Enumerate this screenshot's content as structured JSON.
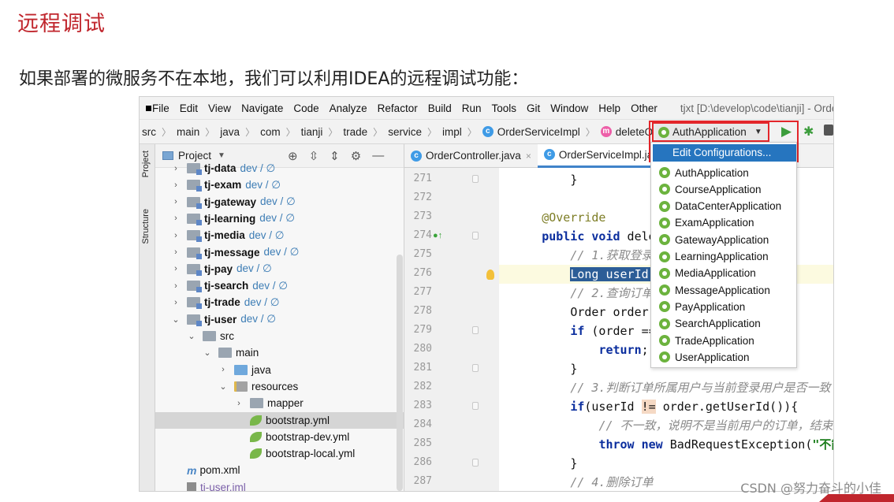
{
  "slide": {
    "title": "远程调试",
    "subtitle": "如果部署的微服务不在本地，我们可以利用IDEA的远程调试功能：",
    "watermark": "CSDN @努力奋斗的小佳"
  },
  "menubar": {
    "items": [
      "File",
      "Edit",
      "View",
      "Navigate",
      "Code",
      "Analyze",
      "Refactor",
      "Build",
      "Run",
      "Tools",
      "Git",
      "Window",
      "Help",
      "Other"
    ],
    "window_title": "tjxt [D:\\develop\\code\\tianji] - OrderSe"
  },
  "breadcrumb": {
    "items": [
      "src",
      "main",
      "java",
      "com",
      "tianji",
      "trade",
      "service",
      "impl"
    ],
    "class_name": "OrderServiceImpl",
    "method_name": "deleteOrder"
  },
  "run_config": {
    "selected": "AuthApplication",
    "edit_label": "Edit Configurations...",
    "options": [
      "AuthApplication",
      "CourseApplication",
      "DataCenterApplication",
      "ExamApplication",
      "GatewayApplication",
      "LearningApplication",
      "MediaApplication",
      "MessageApplication",
      "PayApplication",
      "SearchApplication",
      "TradeApplication",
      "UserApplication"
    ]
  },
  "side_tabs": {
    "project": "Project",
    "structure": "Structure"
  },
  "project": {
    "header": "Project",
    "tree": [
      {
        "name": "tj-data",
        "branch": "dev / ∅",
        "arrow": "›",
        "kind": "module",
        "level": 0
      },
      {
        "name": "tj-exam",
        "branch": "dev / ∅",
        "arrow": "›",
        "kind": "module",
        "level": 0
      },
      {
        "name": "tj-gateway",
        "branch": "dev / ∅",
        "arrow": "›",
        "kind": "module",
        "level": 0
      },
      {
        "name": "tj-learning",
        "branch": "dev / ∅",
        "arrow": "›",
        "kind": "module",
        "level": 0
      },
      {
        "name": "tj-media",
        "branch": "dev / ∅",
        "arrow": "›",
        "kind": "module",
        "level": 0
      },
      {
        "name": "tj-message",
        "branch": "dev / ∅",
        "arrow": "›",
        "kind": "module",
        "level": 0
      },
      {
        "name": "tj-pay",
        "branch": "dev / ∅",
        "arrow": "›",
        "kind": "module",
        "level": 0
      },
      {
        "name": "tj-search",
        "branch": "dev / ∅",
        "arrow": "›",
        "kind": "module",
        "level": 0
      },
      {
        "name": "tj-trade",
        "branch": "dev / ∅",
        "arrow": "›",
        "kind": "module",
        "level": 0
      },
      {
        "name": "tj-user",
        "branch": "dev / ∅",
        "arrow": "⌄",
        "kind": "module",
        "level": 0
      },
      {
        "name": "src",
        "branch": "",
        "arrow": "⌄",
        "kind": "folder",
        "level": 1
      },
      {
        "name": "main",
        "branch": "",
        "arrow": "⌄",
        "kind": "folder",
        "level": 2
      },
      {
        "name": "java",
        "branch": "",
        "arrow": "›",
        "kind": "blue",
        "level": 3
      },
      {
        "name": "resources",
        "branch": "",
        "arrow": "⌄",
        "kind": "res",
        "level": 3
      },
      {
        "name": "mapper",
        "branch": "",
        "arrow": "›",
        "kind": "folder",
        "level": 4
      },
      {
        "name": "bootstrap.yml",
        "branch": "",
        "arrow": "",
        "kind": "yml",
        "level": 5
      },
      {
        "name": "bootstrap-dev.yml",
        "branch": "",
        "arrow": "",
        "kind": "yml",
        "level": 5
      },
      {
        "name": "bootstrap-local.yml",
        "branch": "",
        "arrow": "",
        "kind": "yml",
        "level": 5
      },
      {
        "name": "pom.xml",
        "branch": "",
        "arrow": "",
        "kind": "pom",
        "level": 1
      },
      {
        "name": "tj-user.iml",
        "branch": "",
        "arrow": "",
        "kind": "iml",
        "level": 1
      }
    ]
  },
  "editor": {
    "tabs": [
      {
        "label": "OrderController.java",
        "close": "×"
      },
      {
        "label": "OrderServiceImpl.ja",
        "close": ""
      }
    ],
    "line_numbers": [
      "271",
      "272",
      "273",
      "274",
      "275",
      "276",
      "277",
      "278",
      "279",
      "280",
      "281",
      "282",
      "283",
      "284",
      "285",
      "286",
      "287"
    ]
  },
  "code": {
    "l271": "}",
    "l273": "@Override",
    "l274_kw": "public void",
    "l274_rest": " deleteO",
    "l275": "// 1.获取登录用户",
    "l276_sel": "Long userId = U",
    "l276_end": ");",
    "l277": "// 2.查询订单",
    "l278": "Order order = g",
    "l279_kw": "if",
    "l279_rest": " (order == nu",
    "l280_kw": "return",
    "l280_rest": ";",
    "l281": "}",
    "l282": "// 3.判断订单所属用户与当前登录用户是否一致",
    "l283_kw": "if",
    "l283_a": "(userId ",
    "l283_neq": "!=",
    "l283_b": " order.getUserId()){",
    "l284": "// 不一致，说明不是当前用户的订单，结束",
    "l285_kw1": "throw",
    "l285_kw2": "new",
    "l285_rest": " BadRequestException(",
    "l285_str": "\"不能删",
    "l286": "}",
    "l287": "// 4.删除订单"
  },
  "colors": {
    "title_red": "#c0262d",
    "highlight_box": "#e3262b",
    "selection_blue": "#2675bf"
  }
}
